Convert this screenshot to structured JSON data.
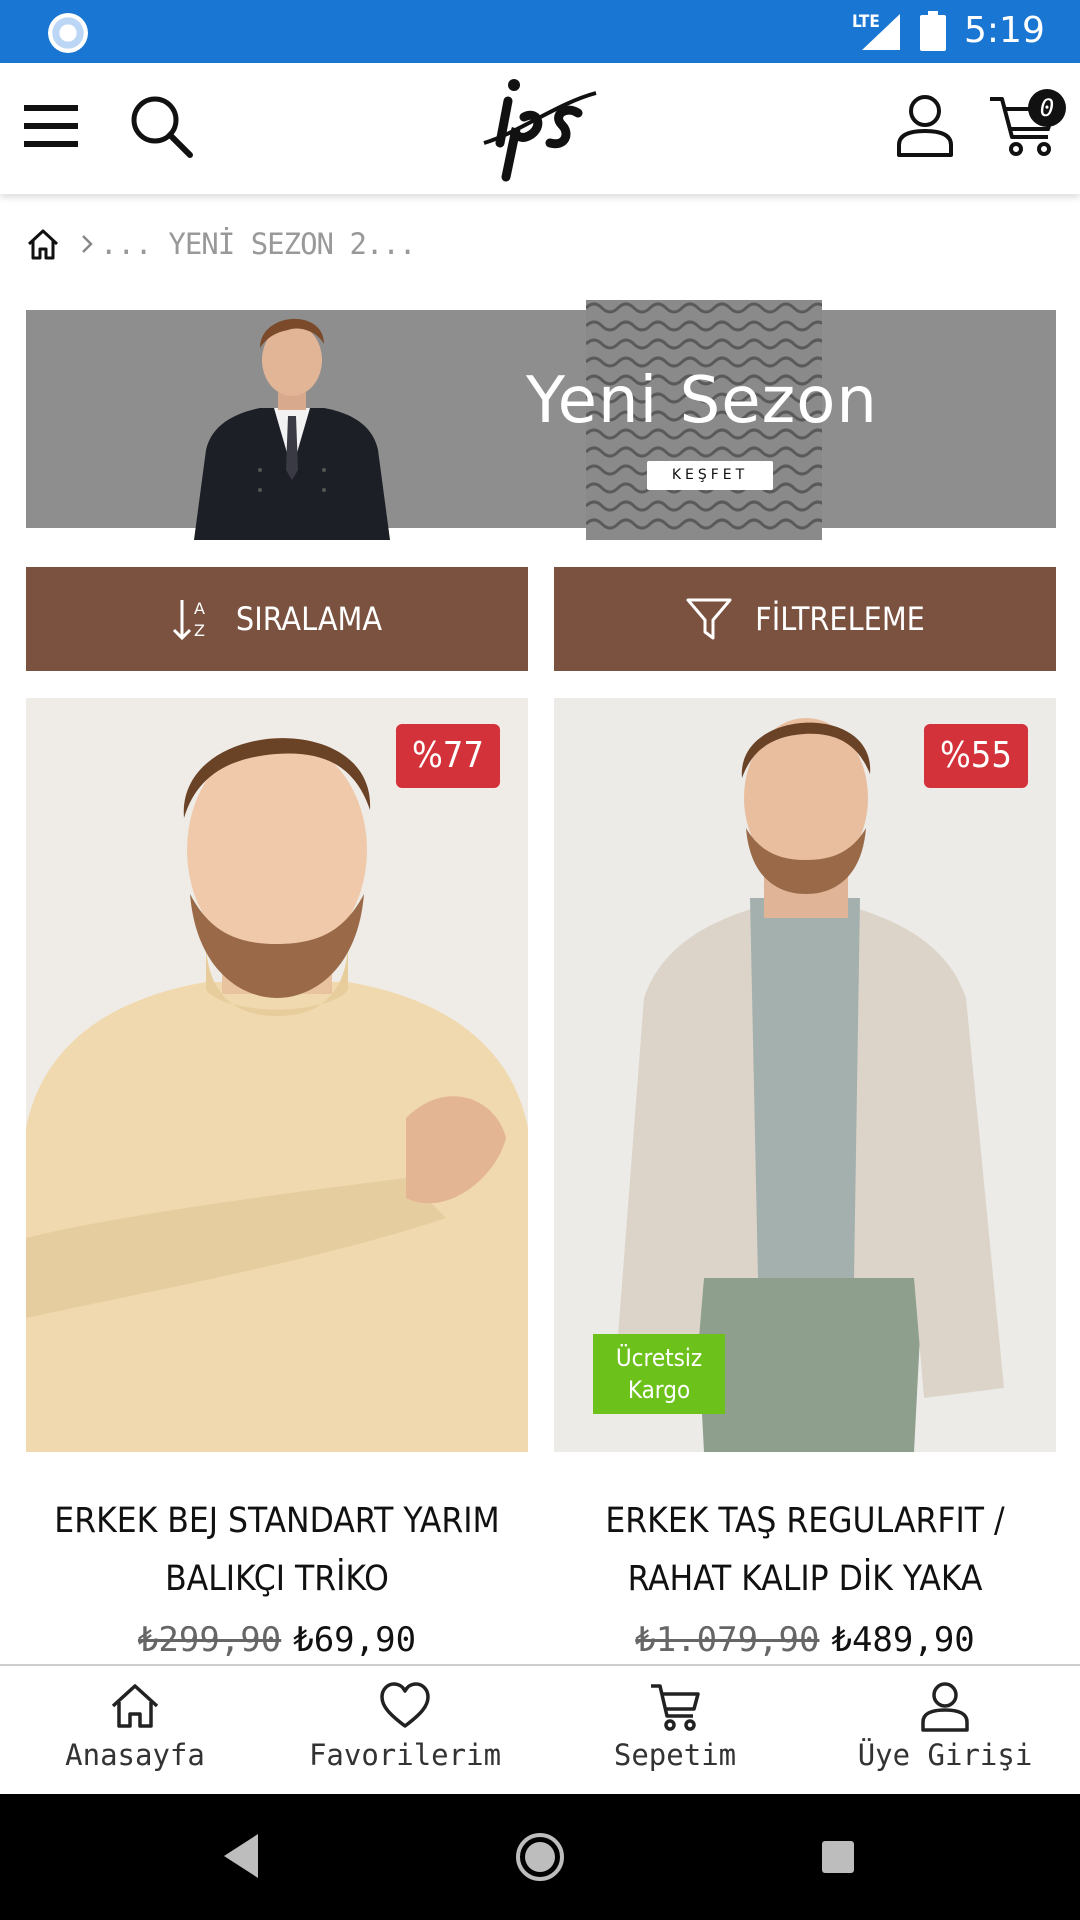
{
  "status_bar": {
    "network": "LTE",
    "time": "5:19"
  },
  "header": {
    "cart_count": "0"
  },
  "breadcrumb": {
    "ellipsis": "...",
    "current": "YENİ SEZON 2..."
  },
  "banner": {
    "title": "Yeni Sezon",
    "button": "KEŞFET"
  },
  "actions": {
    "sort_label": "SIRALAMA",
    "filter_label": "FİLTRELEME"
  },
  "products": [
    {
      "discount": "%77",
      "title": "ERKEK BEJ STANDART YARIM BALIKÇI TRİKO",
      "old_price": "₺299,90",
      "price": "₺69,90"
    },
    {
      "discount": "%55",
      "free_shipping": "Ücretsiz Kargo",
      "title": "ERKEK TAŞ REGULARFIT / RAHAT KALIP DİK YAKA",
      "old_price": "₺1.079,90",
      "price": "₺489,90"
    }
  ],
  "bottom_nav": [
    {
      "label": "Anasayfa",
      "icon": "home-icon"
    },
    {
      "label": "Favorilerim",
      "icon": "heart-icon"
    },
    {
      "label": "Sepetim",
      "icon": "cart-icon"
    },
    {
      "label": "Üye Girişi",
      "icon": "user-icon"
    }
  ],
  "colors": {
    "status_bar": "#1976d2",
    "action_button": "#7b5240",
    "discount_badge": "#d3323a",
    "free_shipping_badge": "#6cc11b",
    "banner_bg": "#8e8e8e"
  }
}
